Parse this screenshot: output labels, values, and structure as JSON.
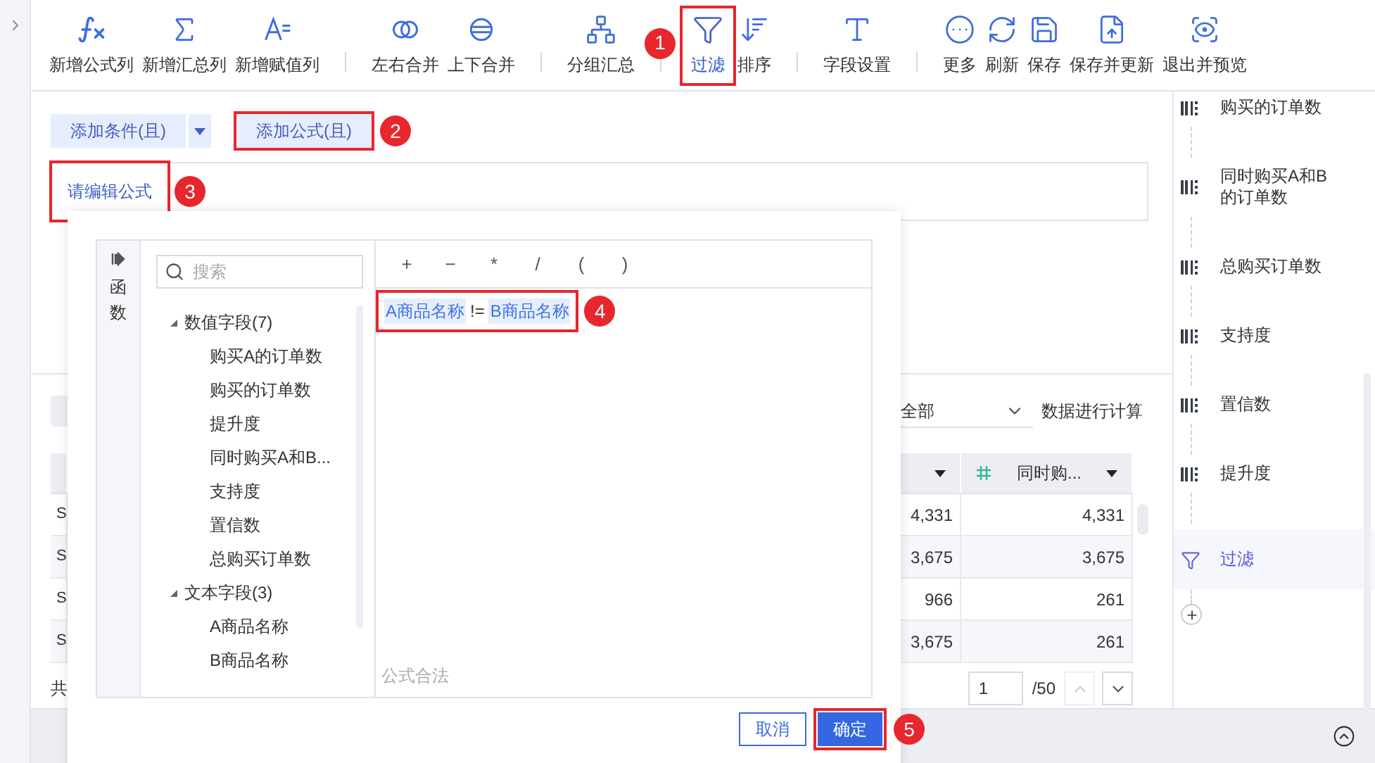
{
  "toolbar": [
    {
      "label": "新增公式列",
      "kind": "formula",
      "separator_before": false,
      "selected": false
    },
    {
      "label": "新增汇总列",
      "kind": "sum",
      "separator_before": false,
      "selected": false
    },
    {
      "label": "新增赋值列",
      "kind": "assign",
      "separator_before": false,
      "selected": false
    },
    {
      "label": "左右合并",
      "kind": "join_lr",
      "separator_before": true,
      "selected": false
    },
    {
      "label": "上下合并",
      "kind": "join_tb",
      "separator_before": false,
      "selected": false
    },
    {
      "label": "分组汇总",
      "kind": "group",
      "separator_before": true,
      "selected": false
    },
    {
      "label": "过滤",
      "kind": "filter",
      "separator_before": true,
      "selected": true,
      "callout": "1"
    },
    {
      "label": "排序",
      "kind": "sort",
      "separator_before": false,
      "selected": false
    },
    {
      "label": "字段设置",
      "kind": "fields",
      "separator_before": true,
      "selected": false
    },
    {
      "label": "更多",
      "kind": "more",
      "separator_before": true,
      "selected": false
    },
    {
      "label": "刷新",
      "kind": "refresh",
      "separator_before": false,
      "selected": false
    },
    {
      "label": "保存",
      "kind": "save",
      "separator_before": false,
      "selected": false
    },
    {
      "label": "保存并更新",
      "kind": "save_update",
      "separator_before": false,
      "selected": false
    },
    {
      "label": "退出并预览",
      "kind": "preview",
      "separator_before": false,
      "selected": false
    }
  ],
  "filter_buttons": [
    {
      "label": "添加条件(且)",
      "kind": "dropdown"
    },
    {
      "label": "添加公式(且)",
      "kind": "plain",
      "callout": "2"
    }
  ],
  "formula_field": {
    "placeholder": "请编辑公式",
    "callout": "3"
  },
  "data_panel": {
    "scope": "全部",
    "calc_label": "数据进行计算",
    "columns": [
      {
        "kind": "text"
      },
      {
        "kind": "number"
      },
      {
        "kind": "number",
        "label": "同时购..."
      }
    ],
    "rows": [
      {
        "cells": [
          "S",
          "4,331",
          "4,331"
        ]
      },
      {
        "cells": [
          "S",
          "3,675",
          "3,675"
        ]
      },
      {
        "cells": [
          "S",
          "966",
          "261"
        ]
      },
      {
        "cells": [
          "S",
          "3,675",
          "261"
        ]
      }
    ],
    "footer": "共",
    "pagination": {
      "page": "1",
      "total": "/50"
    }
  },
  "editor_dialog": {
    "side_tab": "函数",
    "search": {
      "placeholder": "搜索"
    },
    "field_groups": [
      {
        "label": "数值字段(7)",
        "expanded": true,
        "children": [
          {
            "label": "购买A的订单数"
          },
          {
            "label": "购买的订单数"
          },
          {
            "label": "提升度"
          },
          {
            "label": "同时购买A和B..."
          },
          {
            "label": "支持度"
          },
          {
            "label": "置信数"
          },
          {
            "label": "总购买订单数"
          }
        ]
      },
      {
        "label": "文本字段(3)",
        "expanded": true,
        "children": [
          {
            "label": "A商品名称"
          },
          {
            "label": "B商品名称"
          }
        ]
      }
    ],
    "operators": [
      "+",
      "−",
      "*",
      "/",
      "(",
      ")"
    ],
    "formula": [
      {
        "kind": "field",
        "text": "A商品名称"
      },
      {
        "kind": "operator",
        "text": "!="
      },
      {
        "kind": "field",
        "text": "B商品名称"
      }
    ],
    "formula_callout": "4",
    "status": "公式合法",
    "buttons": [
      {
        "label": "取消",
        "kind": "secondary"
      },
      {
        "label": "确定",
        "kind": "primary",
        "callout": "5"
      }
    ]
  },
  "steps": [
    {
      "label": "购买的订单数",
      "kind": "field",
      "selected": false
    },
    {
      "label": "同时购买A和B的订单数",
      "kind": "field",
      "selected": false
    },
    {
      "label": "总购买订单数",
      "kind": "field",
      "selected": false
    },
    {
      "label": "支持度",
      "kind": "field",
      "selected": false
    },
    {
      "label": "置信数",
      "kind": "field",
      "selected": false
    },
    {
      "label": "提升度",
      "kind": "field",
      "selected": false
    },
    {
      "label": "过滤",
      "kind": "filter",
      "selected": true
    }
  ]
}
